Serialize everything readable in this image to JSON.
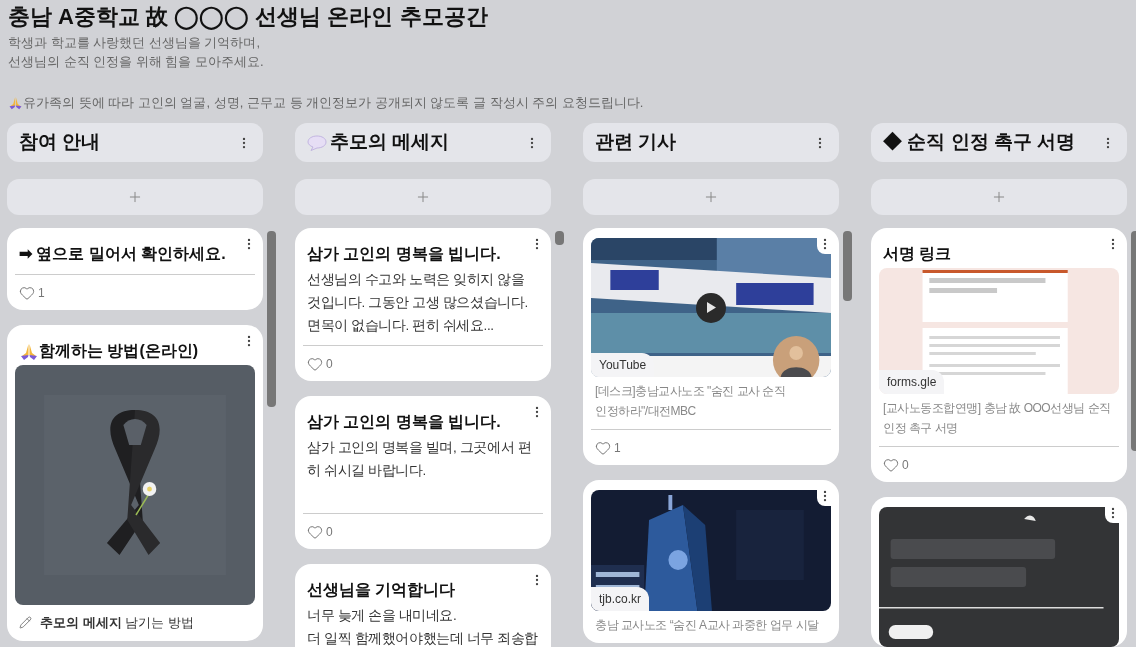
{
  "board": {
    "title": "충남 A중학교 故 ◯◯◯ 선생님 온라인 추모공간",
    "description": [
      "학생과 학교를 사랑했던 선생님을 기억하며,",
      "선생님의 순직 인정을 위해 힘을 모아주세요."
    ],
    "notice": "유가족의 뜻에 따라 고인의 얼굴, 성명, 근무교 등 개인정보가 공개되지 않도록 글 작성시 주의 요청드립니다."
  },
  "columns": [
    {
      "title": "참여 안내",
      "icon": false,
      "posts": [
        {
          "title": "➡ 옆으로 밀어서 확인하세요.",
          "title_icon": false,
          "likes": "1"
        },
        {
          "title": "함께하는 방법(온라인)",
          "title_icon": true,
          "media": {
            "kind": "picture"
          },
          "note": "**추모의 메세지** 남기는 방법"
        }
      ]
    },
    {
      "title": "추모의 메세지",
      "icon": true,
      "posts": [
        {
          "title": "삼가 고인의 명복을 빕니다.",
          "title_icon": false,
          "body": "선생님의 수고와 노력은 잊히지 않을 것입니다. 그동안 고생 많으셨습니다. 면목이 없습니다. 편히 쉬세요...",
          "likes": "0"
        },
        {
          "title": "삼가 고인의 명복을 빕니다.",
          "title_icon": false,
          "body": "삼가 고인의 명복을 빌며, 그곳에서 편히 쉬시길 바랍니다.",
          "likes": "0"
        },
        {
          "title": "선생님을 기억합니다",
          "title_icon": false,
          "body": "너무 늦게 손을 내미네요.\n더 일찍 함께했어야했는데 너무 죄송합"
        }
      ]
    },
    {
      "title": "관련 기사",
      "icon": false,
      "posts": [
        {
          "attachment": {
            "kind": "video",
            "source": "YouTube",
            "caption": "[데스크]충남교사노조 \"숨진 교사 순직 인정하라\"/대전MBC"
          },
          "likes": "1"
        },
        {
          "attachment": {
            "kind": "link",
            "source": "tjb.co.kr",
            "caption": "충남 교사노조 “숨진 A교사 과중한 업무 시달"
          }
        }
      ]
    },
    {
      "title": "◆ 순직 인정 촉구 서명",
      "icon": false,
      "posts": [
        {
          "title": "서명 링크",
          "title_icon": false,
          "attachment": {
            "kind": "link",
            "source": "forms.gle",
            "caption": "[교사노동조합연맹] 충남 故 OOO선생님 순직 인정 촉구 서명"
          },
          "likes": "0"
        },
        {
          "media": {
            "kind": "picture"
          }
        }
      ]
    }
  ]
}
